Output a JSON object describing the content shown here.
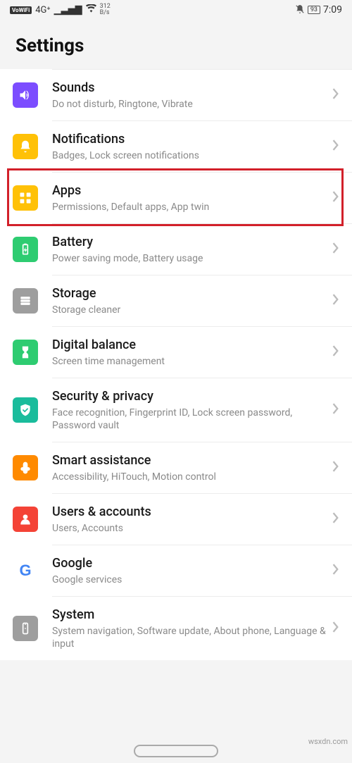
{
  "status": {
    "vowifi": "VoWiFi",
    "net_gen": "4G⁺",
    "speed_top": "312",
    "speed_bot": "B/s",
    "battery": "93",
    "time": "7:09"
  },
  "header": {
    "title": "Settings"
  },
  "items": [
    {
      "id": "sounds",
      "title": "Sounds",
      "sub": "Do not disturb, Ringtone, Vibrate",
      "color": "#7c4dff"
    },
    {
      "id": "notifications",
      "title": "Notifications",
      "sub": "Badges, Lock screen notifications",
      "color": "#ffc107"
    },
    {
      "id": "apps",
      "title": "Apps",
      "sub": "Permissions, Default apps, App twin",
      "color": "#ffc107"
    },
    {
      "id": "battery",
      "title": "Battery",
      "sub": "Power saving mode, Battery usage",
      "color": "#2ecc71"
    },
    {
      "id": "storage",
      "title": "Storage",
      "sub": "Storage cleaner",
      "color": "#9e9e9e"
    },
    {
      "id": "digital-balance",
      "title": "Digital balance",
      "sub": "Screen time management",
      "color": "#2ecc71"
    },
    {
      "id": "security",
      "title": "Security & privacy",
      "sub": "Face recognition, Fingerprint ID, Lock screen password, Password vault",
      "color": "#1abc9c"
    },
    {
      "id": "smart-assist",
      "title": "Smart assistance",
      "sub": "Accessibility, HiTouch, Motion control",
      "color": "#ff8a00"
    },
    {
      "id": "users",
      "title": "Users & accounts",
      "sub": "Users, Accounts",
      "color": "#f44336"
    },
    {
      "id": "google",
      "title": "Google",
      "sub": "Google services",
      "color": "#ffffff"
    },
    {
      "id": "system",
      "title": "System",
      "sub": "System navigation, Software update, About phone, Language & input",
      "color": "#9e9e9e"
    }
  ],
  "watermark": "wsxdn.com"
}
